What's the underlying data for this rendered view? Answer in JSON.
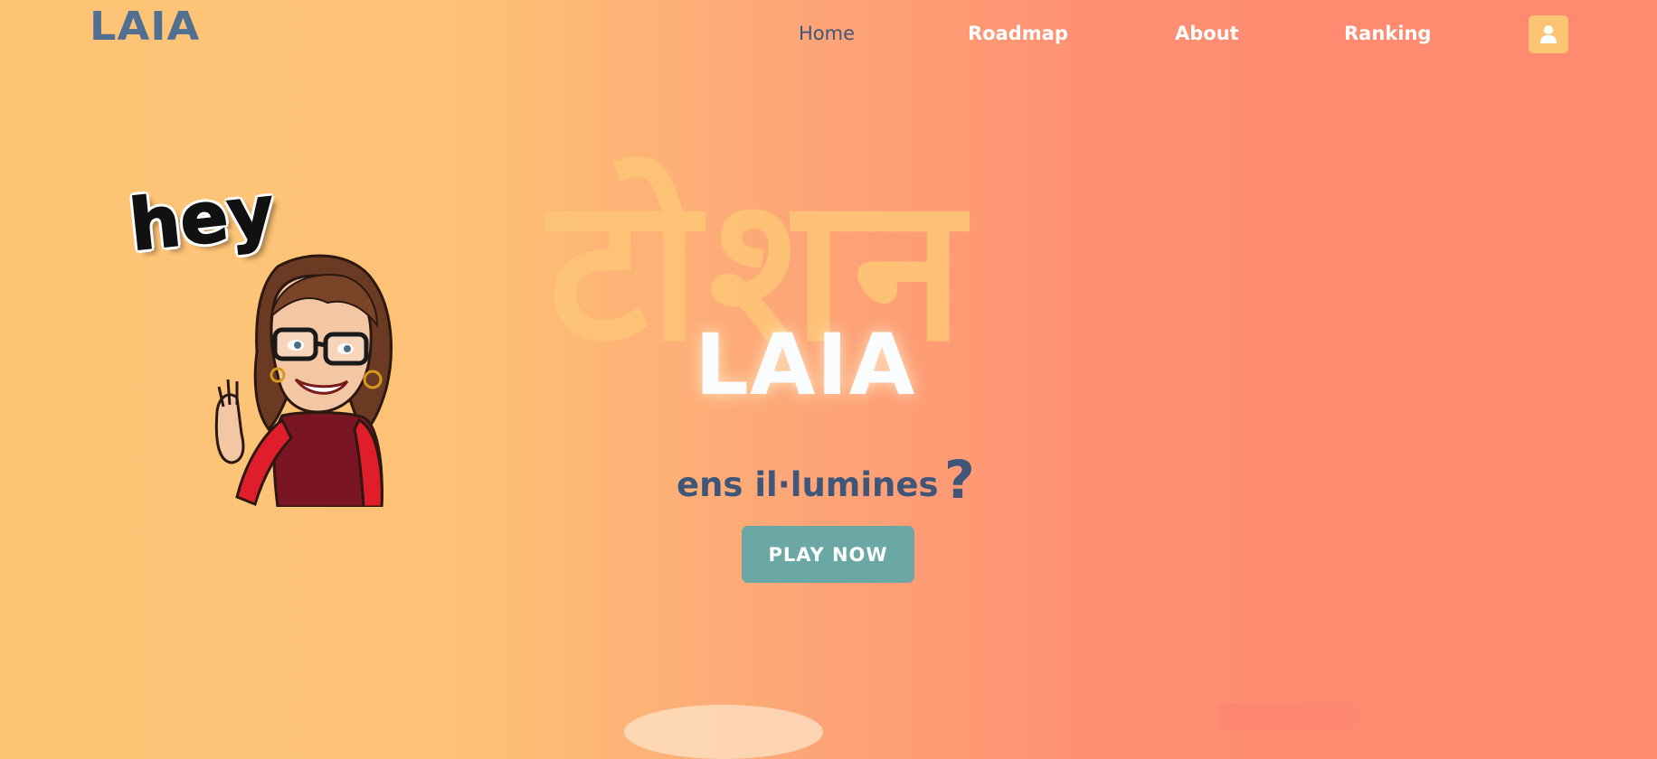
{
  "header": {
    "logo": "LAIA",
    "nav": [
      {
        "label": "Home",
        "active": true
      },
      {
        "label": "Roadmap",
        "active": false
      },
      {
        "label": "About",
        "active": false
      },
      {
        "label": "Ranking",
        "active": false
      }
    ],
    "user_icon": "user-icon"
  },
  "hero": {
    "background_word": "टोशन",
    "title": "LAIA",
    "tagline": "ens il·lumines",
    "tagline_mark": "?",
    "play_label": "PLAY NOW"
  },
  "greeting": {
    "text": "hey",
    "illustration": "waving-woman-avatar"
  },
  "colors": {
    "gradient_start": "#FDC476",
    "gradient_end": "#FF8A70",
    "navy": "#3F5679",
    "logo": "#516F91",
    "teal_button": "#6AA7A5",
    "accent_orange": "#FDC476"
  }
}
